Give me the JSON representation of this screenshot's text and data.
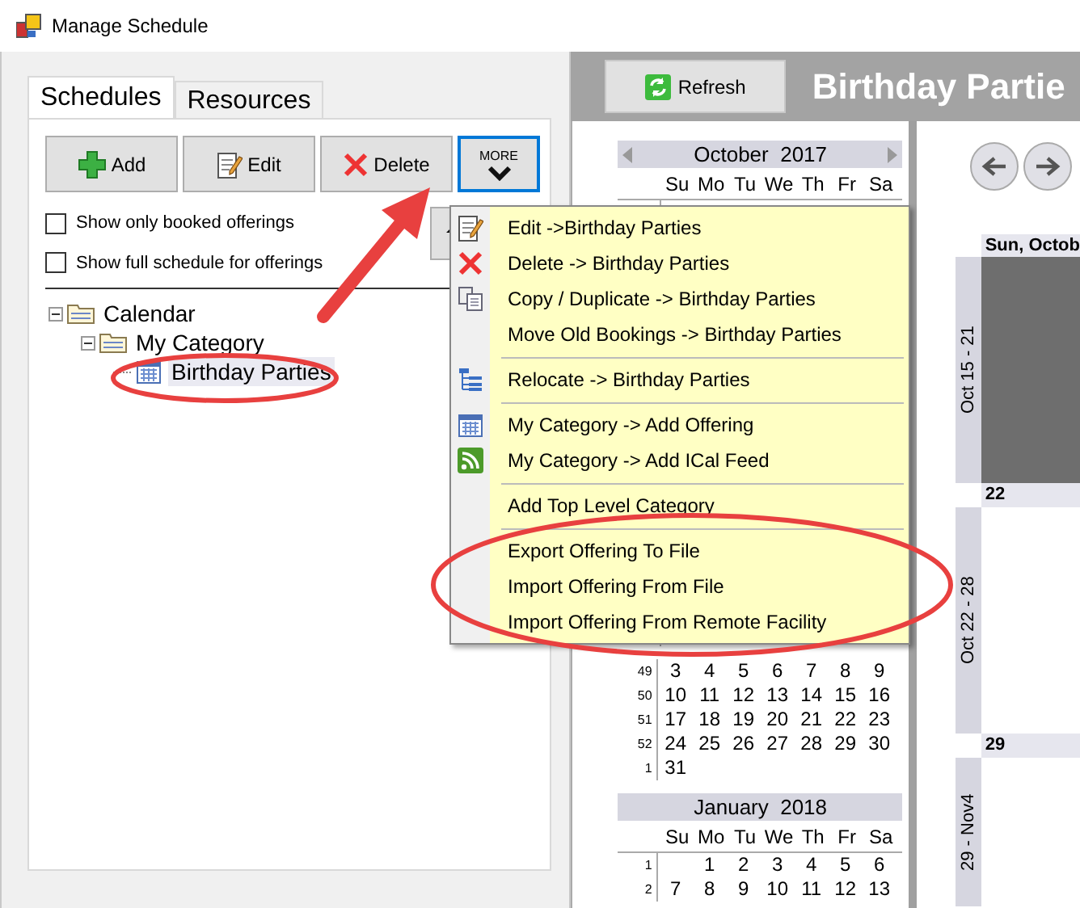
{
  "window": {
    "title": "Manage Schedule"
  },
  "tabs": [
    {
      "label": "Schedules",
      "selected": true
    },
    {
      "label": "Resources",
      "selected": false
    }
  ],
  "toolbar": [
    {
      "kind": "add",
      "label": "Add"
    },
    {
      "kind": "edit",
      "label": "Edit"
    },
    {
      "kind": "delete",
      "label": "Delete"
    },
    {
      "kind": "more",
      "label": "MORE"
    }
  ],
  "options": [
    {
      "label": "Show only booked offerings",
      "checked": false
    },
    {
      "label": "Show full schedule for offerings",
      "checked": false
    }
  ],
  "tree": [
    {
      "label": "Calendar",
      "kind": "folder",
      "expanded": true,
      "selected": false,
      "children": [
        {
          "label": "My Category",
          "kind": "folder",
          "expanded": true,
          "selected": false,
          "children": [
            {
              "label": "Birthday Parties",
              "kind": "calendar",
              "selected": true
            }
          ]
        }
      ]
    }
  ],
  "context_menu": [
    [
      {
        "label": "Edit ->Birthday Parties",
        "kind": "edit"
      },
      {
        "label": "Delete -> Birthday Parties",
        "kind": "delete"
      },
      {
        "label": "Copy / Duplicate -> Birthday Parties",
        "kind": "copy"
      },
      {
        "label": "Move Old Bookings -> Birthday Parties",
        "kind": "plain"
      }
    ],
    [
      {
        "label": "Relocate -> Birthday Parties",
        "kind": "relocate"
      }
    ],
    [
      {
        "label": "My Category -> Add Offering",
        "kind": "calendar"
      },
      {
        "label": "My Category -> Add ICal Feed",
        "kind": "feed"
      }
    ],
    [
      {
        "label": "Add Top Level Category",
        "kind": "plain"
      }
    ],
    [
      {
        "label": "Export Offering To File",
        "kind": "plain"
      },
      {
        "label": "Import Offering From File",
        "kind": "plain"
      },
      {
        "label": "Import Offering From Remote Facility",
        "kind": "plain"
      }
    ]
  ],
  "header": {
    "refresh_button": "Refresh",
    "title": "Birthday Partie"
  },
  "mini_calendars": [
    {
      "title": "October  2017",
      "weekdays": [
        "Su",
        "Mo",
        "Tu",
        "We",
        "Th",
        "Fr",
        "Sa"
      ]
    },
    {
      "weeks": [
        {
          "number": "49",
          "days": [
            "3",
            "4",
            "5",
            "6",
            "7",
            "8",
            "9"
          ]
        },
        {
          "number": "50",
          "days": [
            "10",
            "11",
            "12",
            "13",
            "14",
            "15",
            "16"
          ]
        },
        {
          "number": "51",
          "days": [
            "17",
            "18",
            "19",
            "20",
            "21",
            "22",
            "23"
          ]
        },
        {
          "number": "52",
          "days": [
            "24",
            "25",
            "26",
            "27",
            "28",
            "29",
            "30"
          ]
        },
        {
          "number": "1",
          "days": [
            "31"
          ]
        }
      ]
    },
    {
      "title": "January  2018",
      "weekdays": [
        "Su",
        "Mo",
        "Tu",
        "We",
        "Th",
        "Fr",
        "Sa"
      ],
      "weeks": [
        {
          "number": "1",
          "days": [
            "1",
            "2",
            "3",
            "4",
            "5",
            "6"
          ]
        },
        {
          "number": "2",
          "days": [
            "7",
            "8",
            "9",
            "10",
            "11",
            "12",
            "13"
          ]
        }
      ]
    }
  ],
  "week_view": {
    "column_header": "Sun, Octob",
    "weeks": [
      {
        "label": "Oct 15 - 21",
        "day": "22"
      },
      {
        "label": "Oct 22 - 28",
        "day": "29"
      },
      {
        "label": "29 - Nov4"
      }
    ]
  }
}
